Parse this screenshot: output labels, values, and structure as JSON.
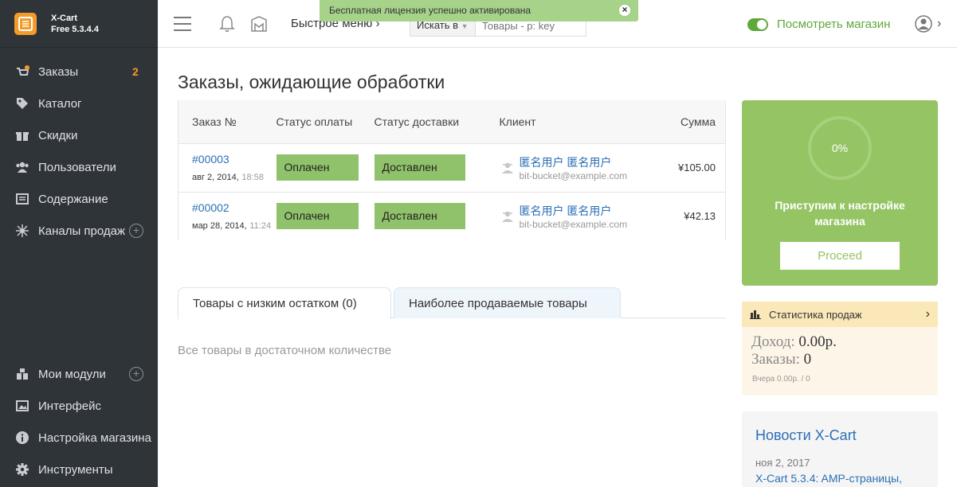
{
  "brand": {
    "name": "X-Cart",
    "version": "Free 5.3.4.4"
  },
  "sidebar": {
    "top": [
      {
        "label": "Заказы",
        "badge": "2"
      },
      {
        "label": "Каталог"
      },
      {
        "label": "Скидки"
      },
      {
        "label": "Пользователи"
      },
      {
        "label": "Содержание"
      },
      {
        "label": "Каналы продаж"
      }
    ],
    "bottom": [
      {
        "label": "Мои модули"
      },
      {
        "label": "Интерфейс"
      },
      {
        "label": "Настройка магазина"
      },
      {
        "label": "Инструменты"
      }
    ]
  },
  "header": {
    "quick_menu": "Быстрое меню",
    "search_select": "Искать в",
    "search_placeholder": "Товары - р: key",
    "store_link": "Посмотреть магазин"
  },
  "notification": {
    "text": "Бесплатная лицензия успешно активирована"
  },
  "main": {
    "title": "Заказы, ожидающие обработки",
    "columns": [
      "Заказ №",
      "Статус оплаты",
      "Статус доставки",
      "Клиент",
      "Сумма"
    ],
    "orders": [
      {
        "number": "#00003",
        "date": "авг 2, 2014,",
        "time": "18:58",
        "payment": "Оплачен",
        "shipping": "Доставлен",
        "client": "匿名用户 匿名用户",
        "email": "bit-bucket@example.com",
        "sum": "¥105.00"
      },
      {
        "number": "#00002",
        "date": "мар 28, 2014,",
        "time": "11:24",
        "payment": "Оплачен",
        "shipping": "Доставлен",
        "client": "匿名用户 匿名用户",
        "email": "bit-bucket@example.com",
        "sum": "¥42.13"
      }
    ],
    "tabs": {
      "low_stock": "Товары с низким остатком (0)",
      "bestsellers": "Наиболее продаваемые товары"
    },
    "empty_text": "Все товары в достаточном количестве"
  },
  "setup": {
    "progress": "0%",
    "text": "Приступим к настройке магазина",
    "button": "Proceed"
  },
  "stats": {
    "title": "Статистика продаж",
    "revenue_label": "Доход:",
    "revenue_value": "0.00р.",
    "orders_label": "Заказы:",
    "orders_value": "0",
    "yesterday": "Вчера 0.00р. / 0"
  },
  "news": {
    "title": "Новости X-Cart",
    "date": "ноя 2, 2017",
    "link": "X-Cart 5.3.4: AMP-страницы,"
  },
  "colors": {
    "sidebar_bg": "#2f3439",
    "accent": "#f39b2b",
    "green": "#95c464",
    "link": "#2b6fb6"
  }
}
